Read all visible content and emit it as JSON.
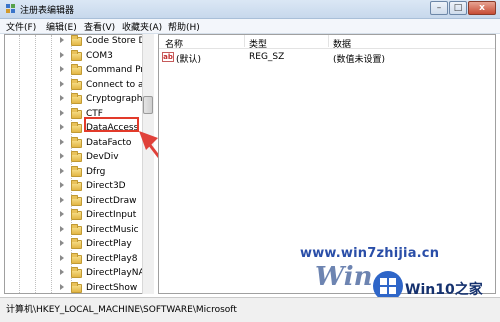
{
  "window": {
    "title": "注册表编辑器",
    "min_label": "–",
    "max_label": "□",
    "close_label": "x"
  },
  "menu": [
    "文件(F)",
    "编辑(E)",
    "查看(V)",
    "收藏夹(A)",
    "帮助(H)"
  ],
  "tree": {
    "items": [
      "Code Store D",
      "COM3",
      "Command Pr",
      "Connect to a",
      "Cryptograph",
      "CTF",
      "DataAccess",
      "DataFacto",
      "DevDiv",
      "Dfrg",
      "Direct3D",
      "DirectDraw",
      "DirectInput",
      "DirectMusic",
      "DirectPlay",
      "DirectPlay8",
      "DirectPlayNA",
      "DirectShow"
    ],
    "selected": "DataAccess",
    "highlight_color": "#e23a2a"
  },
  "list": {
    "headers": [
      "名称",
      "类型",
      "数据"
    ],
    "rows": [
      {
        "icon": "ab",
        "name": "(默认)",
        "type": "REG_SZ",
        "data": "(数值未设置)"
      }
    ]
  },
  "status": "计算机\\HKEY_LOCAL_MACHINE\\SOFTWARE\\Microsoft",
  "watermark": {
    "url": "www.win7zhijia.cn",
    "logo_text": "Win",
    "site": "Win10之家"
  }
}
